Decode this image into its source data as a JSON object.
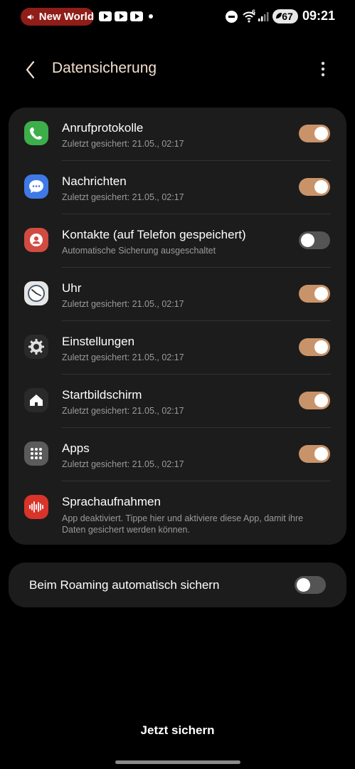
{
  "status_bar": {
    "media_pill_text": "New World",
    "time": "09:21",
    "battery": "67",
    "wifi_badge": "6"
  },
  "header": {
    "title": "Datensicherung"
  },
  "items": [
    {
      "label": "Anrufprotokolle",
      "sub": "Zuletzt gesichert: 21.05., 02:17",
      "icon": "phone-icon",
      "color": "#3cae4a",
      "toggle": "on"
    },
    {
      "label": "Nachrichten",
      "sub": "Zuletzt gesichert: 21.05., 02:17",
      "icon": "messages-icon",
      "color": "#3f79e6",
      "toggle": "on"
    },
    {
      "label": "Kontakte (auf Telefon gespeichert)",
      "sub": "Automatische Sicherung ausgeschaltet",
      "icon": "contacts-icon",
      "color": "#d24b40",
      "toggle": "off"
    },
    {
      "label": "Uhr",
      "sub": "Zuletzt gesichert: 21.05., 02:17",
      "icon": "clock-icon",
      "color": "#e6e6e6",
      "toggle": "on"
    },
    {
      "label": "Einstellungen",
      "sub": "Zuletzt gesichert: 21.05., 02:17",
      "icon": "gear-icon",
      "color": "#2a2a2a",
      "toggle": "on"
    },
    {
      "label": "Startbildschirm",
      "sub": "Zuletzt gesichert: 21.05., 02:17",
      "icon": "home-icon",
      "color": "#2a2a2a",
      "toggle": "on"
    },
    {
      "label": "Apps",
      "sub": "Zuletzt gesichert: 21.05., 02:17",
      "icon": "apps-grid-icon",
      "color": "#5b5b5b",
      "toggle": "on"
    },
    {
      "label": "Sprachaufnahmen",
      "sub": "App deaktiviert. Tippe hier und aktiviere diese App, damit ihre Daten gesichert werden können.",
      "icon": "voice-recorder-icon",
      "color": "#d8342a",
      "toggle": "none"
    }
  ],
  "roaming": {
    "label": "Beim Roaming automatisch sichern",
    "toggle": "off"
  },
  "footer": {
    "backup_button": "Jetzt sichern"
  },
  "accent_color": "#c9936a"
}
